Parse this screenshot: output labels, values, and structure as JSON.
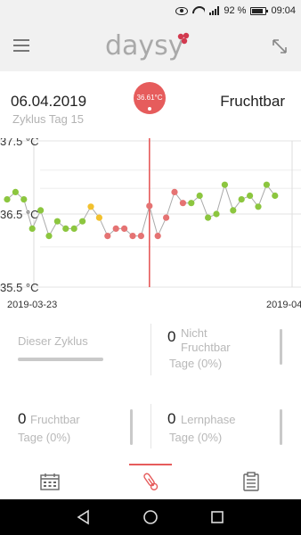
{
  "statusbar": {
    "battery_text": "92 %",
    "time": "09:04",
    "icons": [
      "eye-icon",
      "wifi-icon",
      "signal-icon",
      "battery-icon"
    ]
  },
  "header": {
    "logo_text": "daysy",
    "menu_icon": "hamburger-icon",
    "expand_icon": "expand-arrows-icon",
    "brand_color": "#e65c5c"
  },
  "day": {
    "date": "06.04.2019",
    "cycle_day": "Zyklus Tag 15",
    "status": "Fruchtbar",
    "temperature_bubble": "36.61°C"
  },
  "chart_data": {
    "type": "scatter",
    "y_ticks": [
      "37.5 °C",
      "36.5 °C",
      "35.5 °C"
    ],
    "ylim": [
      35.5,
      37.5
    ],
    "x_tick_labels": [
      "2019-03-23",
      "2019-04"
    ],
    "colors": {
      "fertile": "#e57373",
      "infertile": "#8cc63f",
      "cycle_change": "#f2c12e",
      "line": "#aaaaaa",
      "cursor": "#e65c5c"
    },
    "points": [
      {
        "t": 0,
        "y": 36.7,
        "c": "infertile"
      },
      {
        "t": 1,
        "y": 36.8,
        "c": "infertile"
      },
      {
        "t": 2,
        "y": 36.7,
        "c": "infertile"
      },
      {
        "t": 3,
        "y": 36.3,
        "c": "infertile"
      },
      {
        "t": 4,
        "y": 36.55,
        "c": "infertile"
      },
      {
        "t": 5,
        "y": 36.2,
        "c": "infertile"
      },
      {
        "t": 6,
        "y": 36.4,
        "c": "infertile"
      },
      {
        "t": 7,
        "y": 36.3,
        "c": "infertile"
      },
      {
        "t": 8,
        "y": 36.3,
        "c": "infertile"
      },
      {
        "t": 9,
        "y": 36.4,
        "c": "infertile"
      },
      {
        "t": 10,
        "y": 36.6,
        "c": "cycle_change"
      },
      {
        "t": 11,
        "y": 36.45,
        "c": "cycle_change"
      },
      {
        "t": 12,
        "y": 36.2,
        "c": "fertile"
      },
      {
        "t": 13,
        "y": 36.3,
        "c": "fertile"
      },
      {
        "t": 14,
        "y": 36.3,
        "c": "fertile"
      },
      {
        "t": 15,
        "y": 36.2,
        "c": "fertile"
      },
      {
        "t": 16,
        "y": 36.2,
        "c": "fertile"
      },
      {
        "t": 17,
        "y": 36.61,
        "c": "fertile"
      },
      {
        "t": 18,
        "y": 36.2,
        "c": "fertile"
      },
      {
        "t": 19,
        "y": 36.45,
        "c": "fertile"
      },
      {
        "t": 20,
        "y": 36.8,
        "c": "fertile"
      },
      {
        "t": 21,
        "y": 36.65,
        "c": "fertile"
      },
      {
        "t": 22,
        "y": 36.65,
        "c": "infertile"
      },
      {
        "t": 23,
        "y": 36.75,
        "c": "infertile"
      },
      {
        "t": 24,
        "y": 36.45,
        "c": "infertile"
      },
      {
        "t": 25,
        "y": 36.5,
        "c": "infertile"
      },
      {
        "t": 26,
        "y": 36.9,
        "c": "infertile"
      },
      {
        "t": 27,
        "y": 36.55,
        "c": "infertile"
      },
      {
        "t": 28,
        "y": 36.7,
        "c": "infertile"
      },
      {
        "t": 29,
        "y": 36.75,
        "c": "infertile"
      },
      {
        "t": 30,
        "y": 36.6,
        "c": "infertile"
      },
      {
        "t": 31,
        "y": 36.9,
        "c": "infertile"
      },
      {
        "t": 32,
        "y": 36.75,
        "c": "infertile"
      }
    ],
    "selected_index": 17
  },
  "stats": {
    "current_cycle_label": "Dieser Zyklus",
    "non_fertile_count": "0",
    "non_fertile_label_1": "Nicht",
    "non_fertile_label_2": "Fruchtbar",
    "non_fertile_days": "Tage (0%)",
    "fertile_count": "0",
    "fertile_label": "Fruchtbar",
    "fertile_days": "Tage (0%)",
    "learning_count": "0",
    "learning_label": "Lernphase",
    "learning_days": "Tage (0%)"
  },
  "tabs": [
    {
      "icon": "calendar-icon"
    },
    {
      "icon": "thermometer-icon",
      "active": true
    },
    {
      "icon": "clipboard-icon"
    }
  ],
  "navbar": {
    "icons": [
      "back-icon",
      "home-icon",
      "recents-icon"
    ]
  }
}
